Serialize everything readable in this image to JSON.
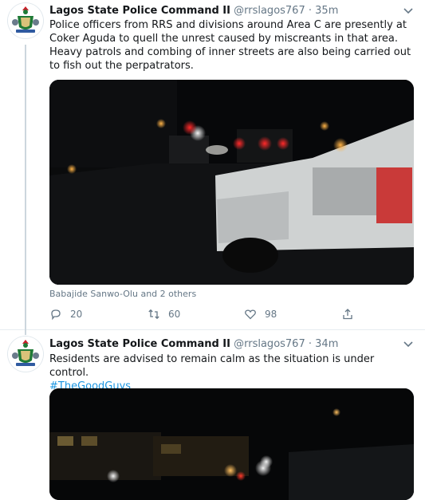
{
  "tweets": [
    {
      "name": "Lagos State Police Command II",
      "handle": "@rrslagos767",
      "separator": "·",
      "time": "35m",
      "text": "Police officers from RRS and divisions around Area C are presently at Coker Aguda to quell the unrest caused by miscreants in that area. Heavy patrols and combing of inner streets are also being carried out to fish out the perpatrators.",
      "liked_by": "Babajide Sanwo-Olu and 2 others",
      "actions": {
        "replies": "20",
        "retweets": "60",
        "likes": "98"
      }
    },
    {
      "name": "Lagos State Police Command II",
      "handle": "@rrslagos767",
      "separator": "·",
      "time": "34m",
      "text": "Residents are advised to remain calm as the situation is under control.",
      "hashtag": "#TheGoodGuys"
    }
  ],
  "icons": {
    "more": "chevron-down-icon",
    "reply": "reply-icon",
    "retweet": "retweet-icon",
    "like": "heart-icon",
    "share": "share-icon",
    "avatar": "police-crest-avatar"
  },
  "colors": {
    "link": "#1b95e0",
    "muted": "#657786",
    "divider": "#e6ecf0"
  }
}
